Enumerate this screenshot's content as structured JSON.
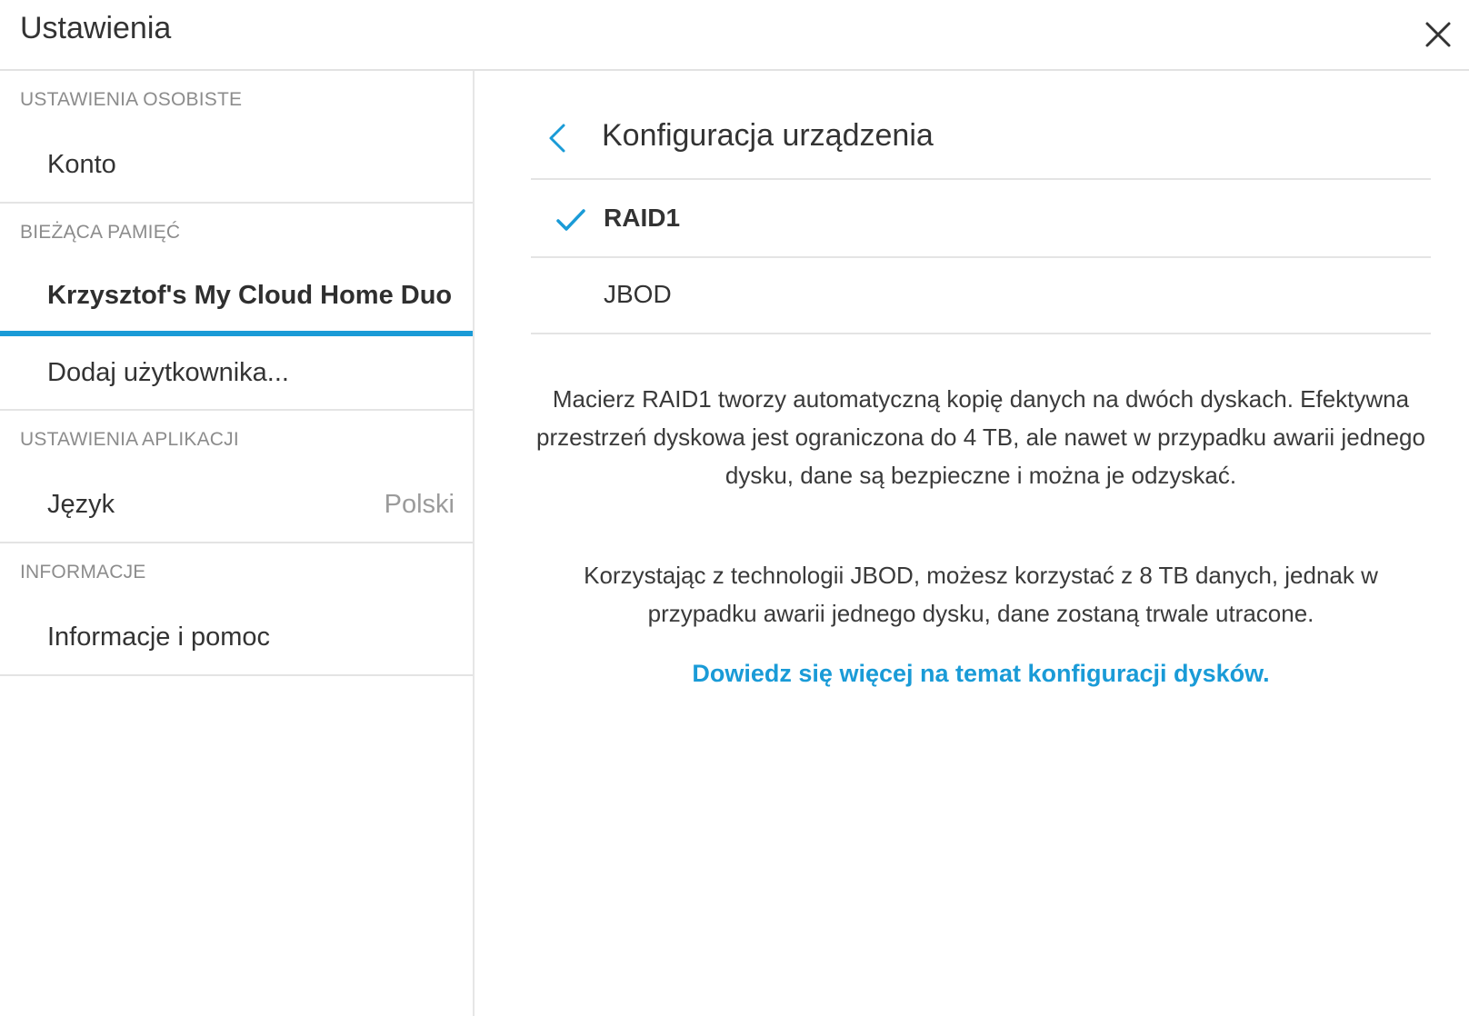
{
  "header": {
    "title": "Ustawienia"
  },
  "sidebar": {
    "sections": [
      {
        "label": "USTAWIENIA OSOBISTE",
        "items": [
          {
            "label": "Konto"
          }
        ]
      },
      {
        "label": "BIEŻĄCA PAMIĘĆ",
        "items": [
          {
            "label": "Krzysztof's My Cloud Home Duo"
          },
          {
            "label": "Dodaj użytkownika..."
          }
        ]
      },
      {
        "label": "USTAWIENIA APLIKACJI",
        "items": [
          {
            "label": "Język",
            "value": "Polski"
          }
        ]
      },
      {
        "label": "INFORMACJE",
        "items": [
          {
            "label": "Informacje i pomoc"
          }
        ]
      }
    ]
  },
  "main": {
    "title": "Konfiguracja urządzenia",
    "options": [
      {
        "label": "RAID1",
        "selected": true
      },
      {
        "label": "JBOD",
        "selected": false
      }
    ],
    "description": [
      "Macierz RAID1 tworzy automatyczną kopię danych na dwóch dyskach. Efektywna przestrzeń dyskowa jest ograniczona do 4 TB, ale nawet w przypadku awarii jednego dysku, dane są bezpieczne i można je odzyskać.",
      "Korzystając z technologii JBOD, możesz korzystać z 8 TB danych, jednak w przypadku awarii jednego dysku, dane zostaną trwale utracone."
    ],
    "link": "Dowiedz się więcej na temat konfiguracji dysków."
  },
  "icons": {
    "close": "close-icon",
    "back": "chevron-left-icon",
    "check": "checkmark-icon"
  },
  "colors": {
    "accent": "#1a9bd7",
    "text": "#333333",
    "muted": "#8c8c8c"
  }
}
